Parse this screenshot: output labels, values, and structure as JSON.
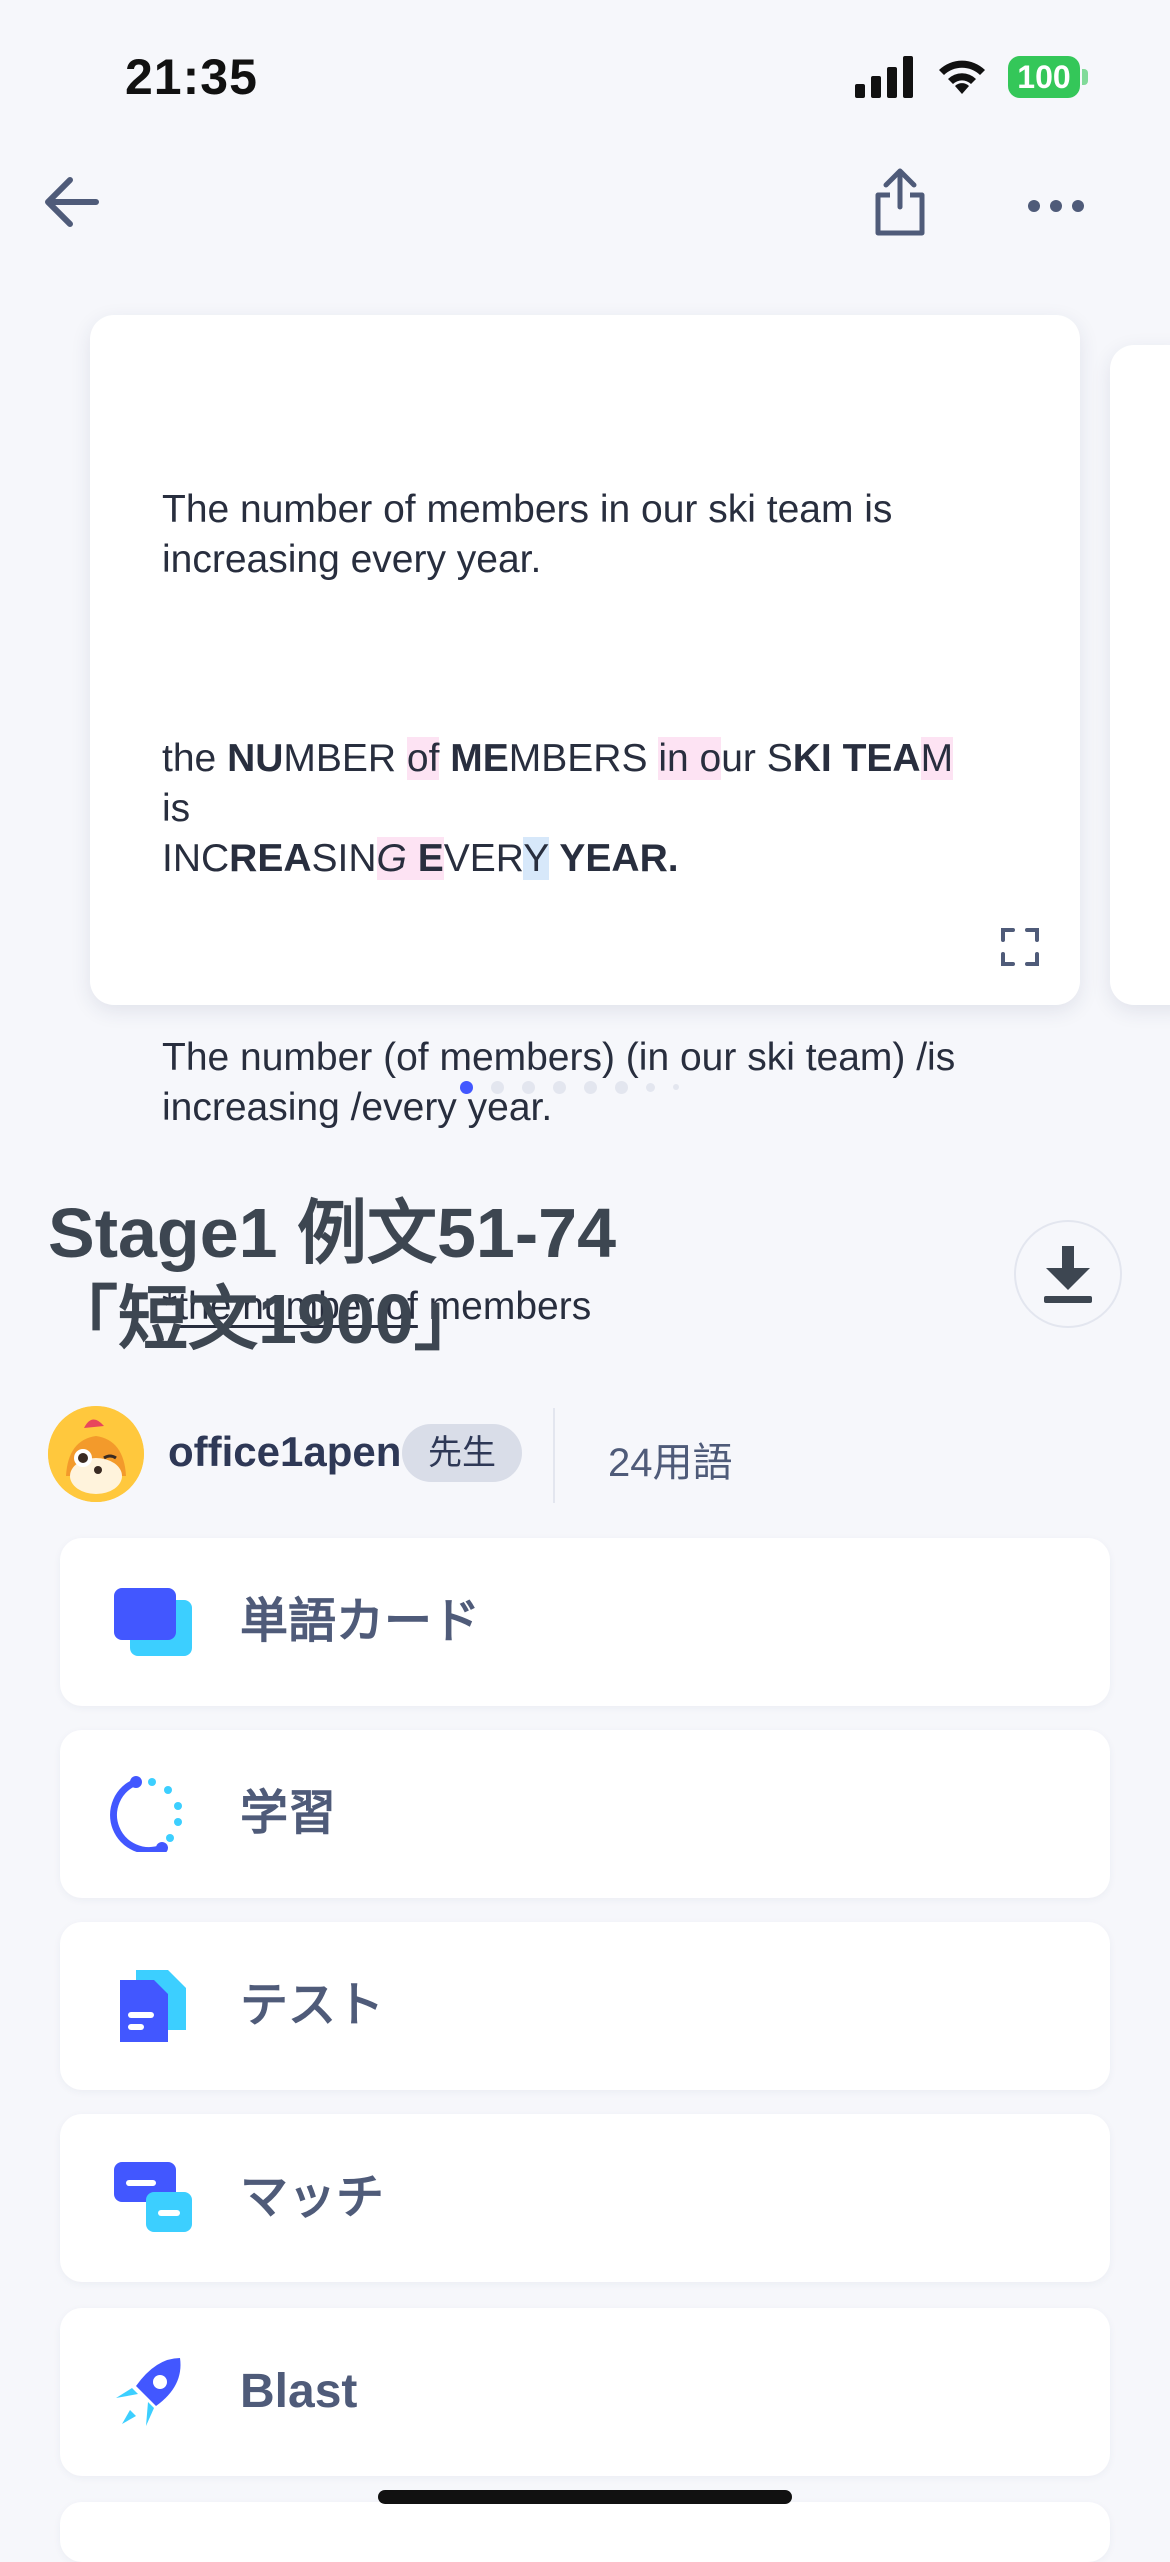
{
  "status_bar": {
    "time": "21:35",
    "battery": "100",
    "battery_color": "#34c759"
  },
  "card": {
    "sentence": "The number of members in our ski team is increasing every year.",
    "syllable_line1": [
      "the ",
      "NU",
      "MBER ",
      "of",
      " ",
      "ME",
      "MBERS ",
      "in o",
      "ur S",
      "KI TEA",
      "M "
    ],
    "syllable_word_is": "is",
    "syllable_line2": [
      "INC",
      "REA",
      "SIN",
      "G",
      " ",
      "E",
      "VER",
      "Y",
      " ",
      "YEAR."
    ],
    "chunked": "The number (of members) (in our ski team) /is increasing /every year.",
    "note_prefix": "*",
    "note_underlined": "the number of",
    "note_suffix": " members"
  },
  "carousel": {
    "total": 8,
    "active": 0
  },
  "set": {
    "title_line1": "Stage1 例文51-74",
    "title_line2": "「短文1900」",
    "author": "office1apen",
    "author_role": "先生",
    "term_count": "24用語"
  },
  "modes": [
    {
      "label": "単語カード",
      "icon": "flashcards-icon"
    },
    {
      "label": "学習",
      "icon": "learn-icon"
    },
    {
      "label": "テスト",
      "icon": "test-icon"
    },
    {
      "label": "マッチ",
      "icon": "match-icon"
    },
    {
      "label": "Blast",
      "icon": "blast-rocket-icon"
    }
  ],
  "colors": {
    "accent": "#4257ff",
    "accent_light": "#3ccfff",
    "highlight_pink": "#fde3f3",
    "highlight_blue": "#d7e8fa"
  }
}
